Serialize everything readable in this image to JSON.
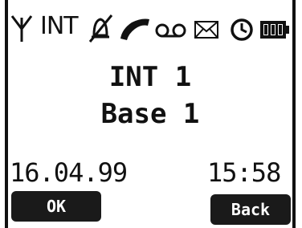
{
  "status_bar": {
    "icons": [
      "antenna-icon",
      "ringer-off-icon",
      "handset-icon",
      "voicemail-icon",
      "envelope-icon",
      "clock-icon",
      "battery-icon"
    ],
    "int_label": "INT"
  },
  "display": {
    "line1": "INT 1",
    "line2": "Base 1",
    "date": "16.04.99",
    "time": "15:58"
  },
  "softkeys": {
    "left_label": "OK",
    "right_label": "Back"
  }
}
